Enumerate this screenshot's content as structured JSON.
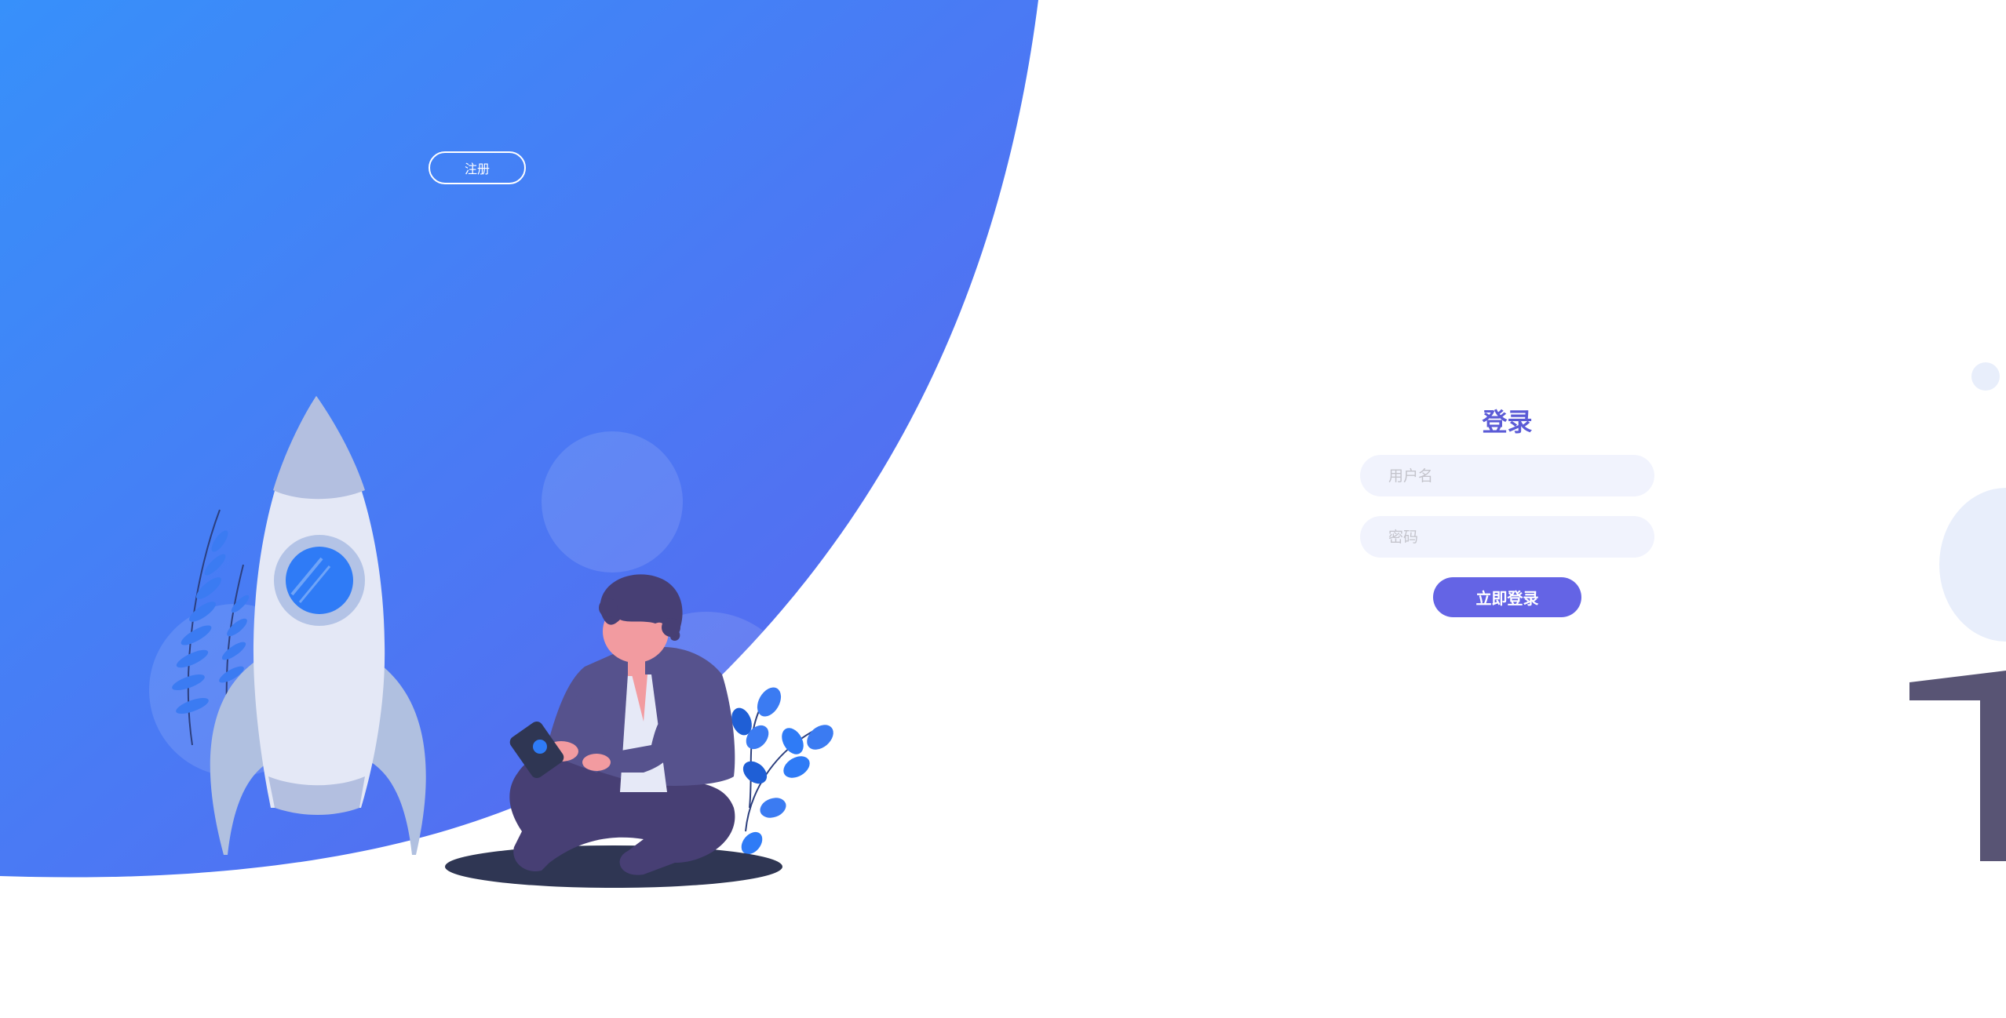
{
  "header": {
    "signup_label": "注册"
  },
  "login": {
    "title": "登录",
    "username_placeholder": "用户名",
    "password_placeholder": "密码",
    "submit_label": "立即登录"
  },
  "colors": {
    "gradient_start": "#3a8ef8",
    "gradient_end": "#5a6cf0",
    "accent": "#6464e5",
    "title": "#5b5bd6",
    "field_bg": "#f1f3fd"
  }
}
